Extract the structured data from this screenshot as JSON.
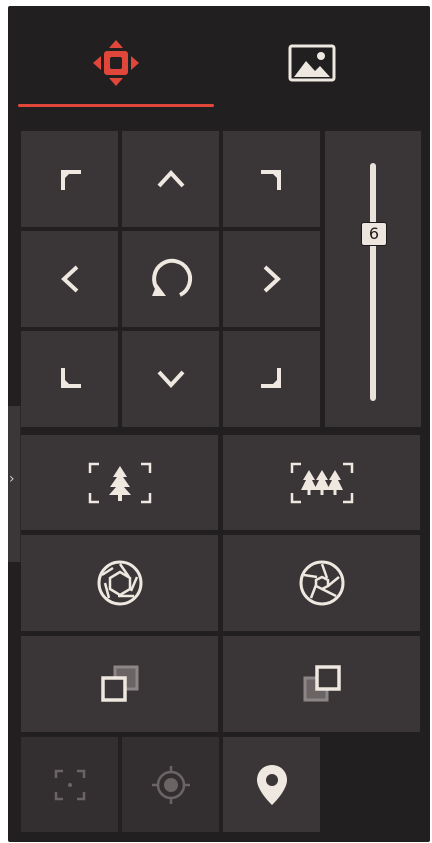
{
  "colors": {
    "panel_bg": "#211f20",
    "button_bg": "#3a3536",
    "icon": "#eee8e1",
    "icon_dim": "#6a6465",
    "accent": "#e0463a"
  },
  "tabs": [
    {
      "id": "ptz",
      "icon": "ptz-direction-icon",
      "active": true
    },
    {
      "id": "image",
      "icon": "image-icon",
      "active": false
    }
  ],
  "directions": {
    "icons": [
      "arrow-up-left-icon",
      "arrow-up-icon",
      "arrow-up-right-icon",
      "arrow-left-icon",
      "auto-rotate-icon",
      "arrow-right-icon",
      "arrow-down-left-icon",
      "arrow-down-icon",
      "arrow-down-right-icon"
    ]
  },
  "zoom_slider": {
    "value": "6",
    "level": 0.3
  },
  "controls": {
    "rows": [
      [
        "zoom-in-tree-icon",
        "zoom-out-trees-icon"
      ],
      [
        "iris-close-icon",
        "iris-open-icon"
      ],
      [
        "focus-near-icon",
        "focus-far-icon"
      ]
    ]
  },
  "bottom_tools": [
    "region-focus-icon",
    "target-locate-icon",
    "location-pin-icon"
  ]
}
